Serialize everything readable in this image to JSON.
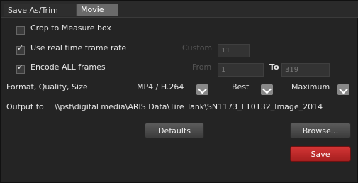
{
  "tabs": [
    "Save As/Trim",
    "Movie"
  ],
  "crop": {
    "label": "Crop to Measure box",
    "checked": false
  },
  "realtime": {
    "label": "Use real time frame rate",
    "checked": true,
    "custom_label": "Custom",
    "custom_value": "11"
  },
  "encode": {
    "label": "Encode ALL frames",
    "checked": true,
    "from_label": "From",
    "from_value": "1",
    "to_label": "To",
    "to_value": "319"
  },
  "format": {
    "label": "Format, Quality, Size",
    "format_value": "MP4 / H.264",
    "quality_value": "Best",
    "size_value": "Maximum"
  },
  "output": {
    "label": "Output to",
    "path": "\\\\psf\\digital media\\ARIS Data\\Tire Tank\\SN1173_L10132_Image_2014"
  },
  "buttons": {
    "defaults": "Defaults",
    "browse": "Browse...",
    "save": "Save"
  }
}
